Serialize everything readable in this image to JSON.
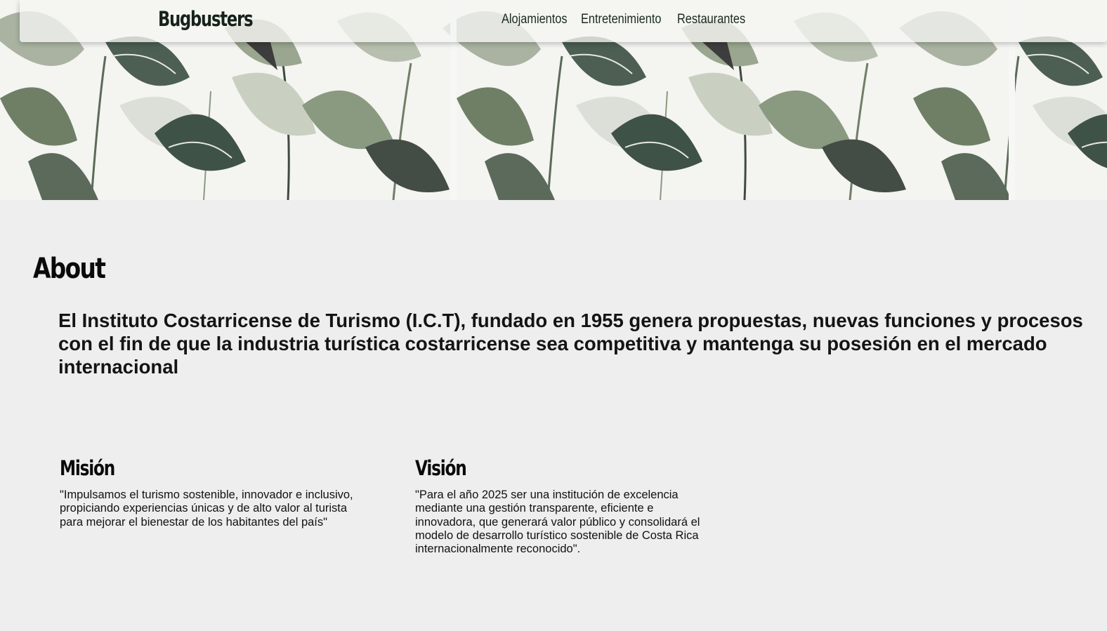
{
  "header": {
    "brand": "Bugbusters",
    "nav": [
      {
        "label": "Alojamientos"
      },
      {
        "label": "Entretenimiento"
      },
      {
        "label": "Restaurantes"
      }
    ]
  },
  "hero": {
    "image": "tropical-leaves-wallpaper"
  },
  "about": {
    "title": "About",
    "text": "El Instituto Costarricense de Turismo (I.C.T), fundado en 1955 genera propuestas, nuevas funciones y procesos con el fin de que la industria turística costarricense sea competitiva y mantenga su posesión en el mercado internacional"
  },
  "mision": {
    "title": "Misión",
    "text": "\"Impulsamos el turismo sostenible, innovador e inclusivo, propiciando experiencias únicas y de alto valor al turista para mejorar el bienestar de los habitantes del país\""
  },
  "vision": {
    "title": "Visión",
    "text": "\"Para el año 2025 ser una institución de excelencia mediante una gestión transparente, eficiente e innovadora, que generará valor público y consolidará el modelo de desarrollo turístico sostenible de Costa Rica internacionalmente reconocido\"."
  },
  "colors": {
    "page_background": "#eeeeee",
    "leaf_dark": "#3f5247",
    "leaf_mid": "#8a9a80",
    "leaf_light": "#c9d0c2"
  }
}
